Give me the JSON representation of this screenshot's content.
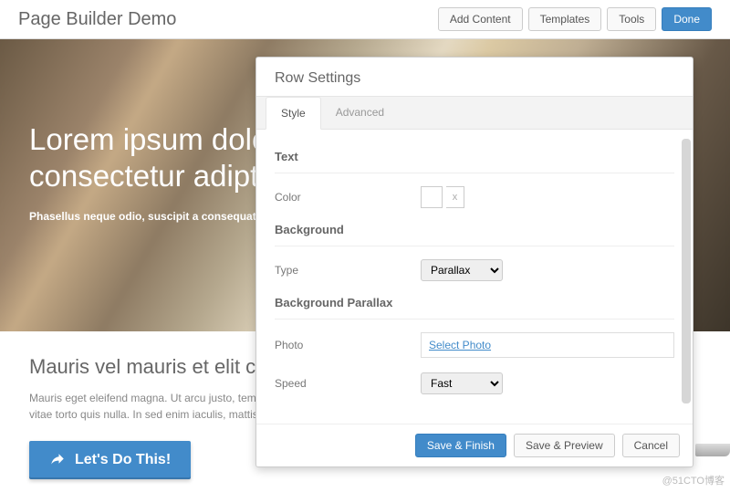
{
  "topbar": {
    "title": "Page Builder Demo",
    "buttons": {
      "add_content": "Add Content",
      "templates": "Templates",
      "tools": "Tools",
      "done": "Done"
    }
  },
  "hero": {
    "heading": "Lorem ipsum dolor consectetur adipt e",
    "sub": "Phasellus neque odio, suscipit a consequat id."
  },
  "below": {
    "title": "Mauris vel mauris et elit com",
    "text": "Mauris eget eleifend magna. Ut arcu justo, tempor id, semper in lacus. Mauris vitae arcu vitae torto quis nulla. In sed enim iaculis, mattis.",
    "cta": "Let's Do This!"
  },
  "modal": {
    "title": "Row Settings",
    "tabs": {
      "style": "Style",
      "advanced": "Advanced"
    },
    "sections": {
      "text": {
        "label": "Text",
        "color_label": "Color",
        "color_clear": "x"
      },
      "background": {
        "label": "Background",
        "type_label": "Type",
        "type_value": "Parallax"
      },
      "bg_parallax": {
        "label": "Background Parallax",
        "photo_label": "Photo",
        "photo_value": "Select Photo",
        "speed_label": "Speed",
        "speed_value": "Fast"
      }
    },
    "footer": {
      "save_finish": "Save & Finish",
      "save_preview": "Save & Preview",
      "cancel": "Cancel"
    }
  },
  "watermark": "@51CTO博客"
}
